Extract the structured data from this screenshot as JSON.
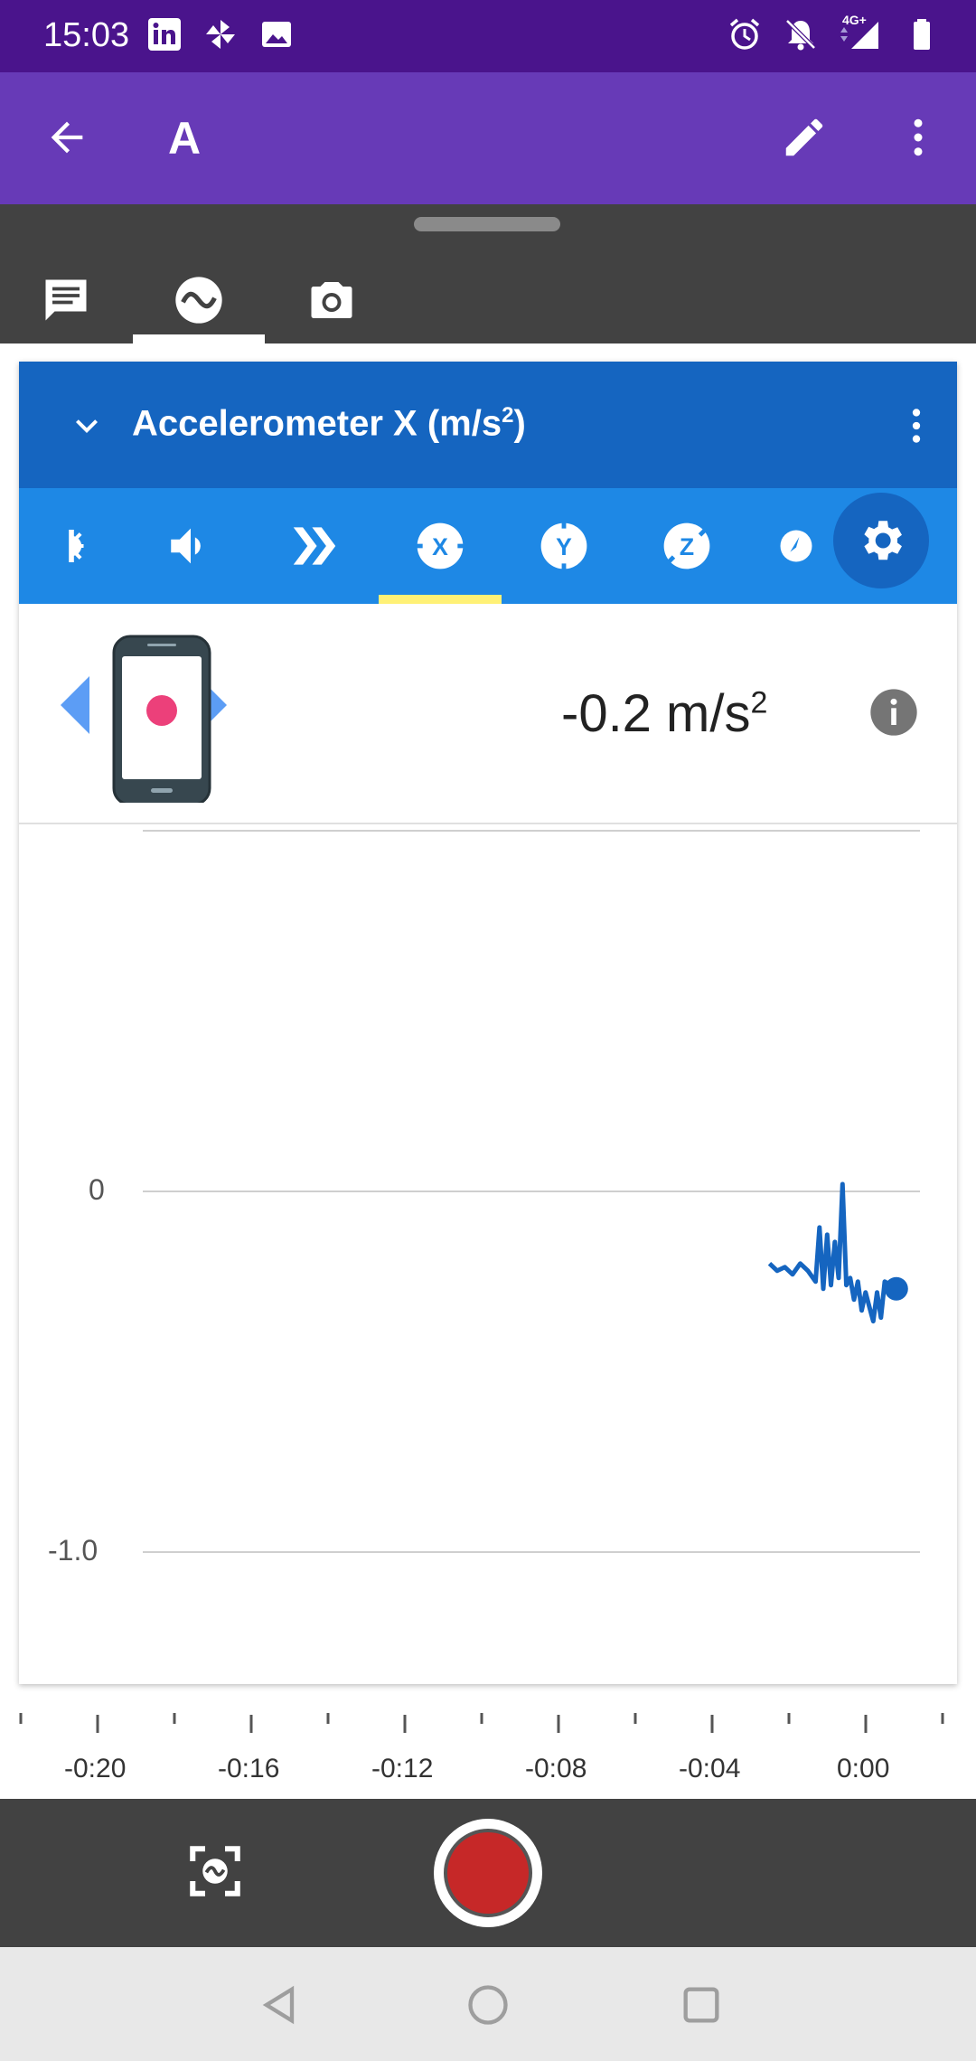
{
  "status_bar": {
    "time": "15:03",
    "left_icons": [
      "linkedin-icon",
      "pinwheel-icon",
      "image-icon"
    ],
    "right_icons": [
      "alarm-icon",
      "bell-off-icon",
      "signal-4g-icon",
      "battery-icon"
    ],
    "network_label": "4G+"
  },
  "app_bar": {
    "title": "A",
    "back_icon": "arrow-back-icon",
    "edit_icon": "pencil-icon",
    "more_icon": "more-vert-icon",
    "color": "#673ab7"
  },
  "panel_tabs": [
    {
      "name": "notes",
      "icon": "comment-icon",
      "selected": false
    },
    {
      "name": "sensors",
      "icon": "wave-icon",
      "selected": true
    },
    {
      "name": "camera",
      "icon": "camera-icon",
      "selected": false
    }
  ],
  "sensor_card": {
    "title": "Accelerometer X (m/s",
    "title_sup": "2",
    "title_suffix": ")",
    "header_color": "#1565c0",
    "sensor_tabs": [
      {
        "name": "brightness",
        "icon": "brightness-icon",
        "selected": false
      },
      {
        "name": "sound",
        "icon": "volume-icon",
        "selected": false
      },
      {
        "name": "linear-accel",
        "icon": "double-chevron-icon",
        "selected": false
      },
      {
        "name": "accel-x",
        "icon": "x-axis-icon",
        "label": "X",
        "selected": true
      },
      {
        "name": "accel-y",
        "icon": "y-axis-icon",
        "label": "Y",
        "selected": false
      },
      {
        "name": "accel-z",
        "icon": "z-axis-icon",
        "label": "Z",
        "selected": false
      },
      {
        "name": "compass",
        "icon": "compass-icon",
        "selected": false
      }
    ],
    "settings_icon": "gear-icon",
    "readout": {
      "value": "-0.2 m/s",
      "sup": "2"
    },
    "info_icon": "info-icon"
  },
  "chart_data": {
    "type": "line",
    "series": [
      {
        "color": "#1565c0",
        "x": [
          -3.0,
          -2.8,
          -2.6,
          -2.4,
          -2.2,
          -2.0,
          -1.8,
          -1.7,
          -1.6,
          -1.5,
          -1.4,
          -1.3,
          -1.2,
          -1.1,
          -1.0,
          -0.9,
          -0.8,
          -0.7,
          -0.6,
          -0.5,
          -0.4,
          -0.3,
          -0.2,
          -0.1,
          0.0,
          0.3
        ],
        "y": [
          -0.2,
          -0.22,
          -0.21,
          -0.23,
          -0.2,
          -0.22,
          -0.25,
          -0.1,
          -0.27,
          -0.12,
          -0.26,
          -0.14,
          -0.24,
          0.02,
          -0.26,
          -0.24,
          -0.3,
          -0.25,
          -0.33,
          -0.28,
          -0.32,
          -0.36,
          -0.28,
          -0.35,
          -0.25,
          -0.27
        ]
      }
    ],
    "y_ticks": [
      "0",
      "-1.0"
    ],
    "x_ticks": [
      "-0:20",
      "-0:16",
      "-0:12",
      "-0:08",
      "-0:04",
      "0:00"
    ],
    "xlim": [
      -22,
      2
    ],
    "ylim": [
      -1.0,
      0
    ]
  },
  "bottom_controls": {
    "snapshot_icon": "snapshot-icon",
    "record_icon": "record-icon"
  },
  "nav_bar": {
    "back_icon": "nav-back-icon",
    "home_icon": "nav-home-icon",
    "recents_icon": "nav-recents-icon"
  }
}
